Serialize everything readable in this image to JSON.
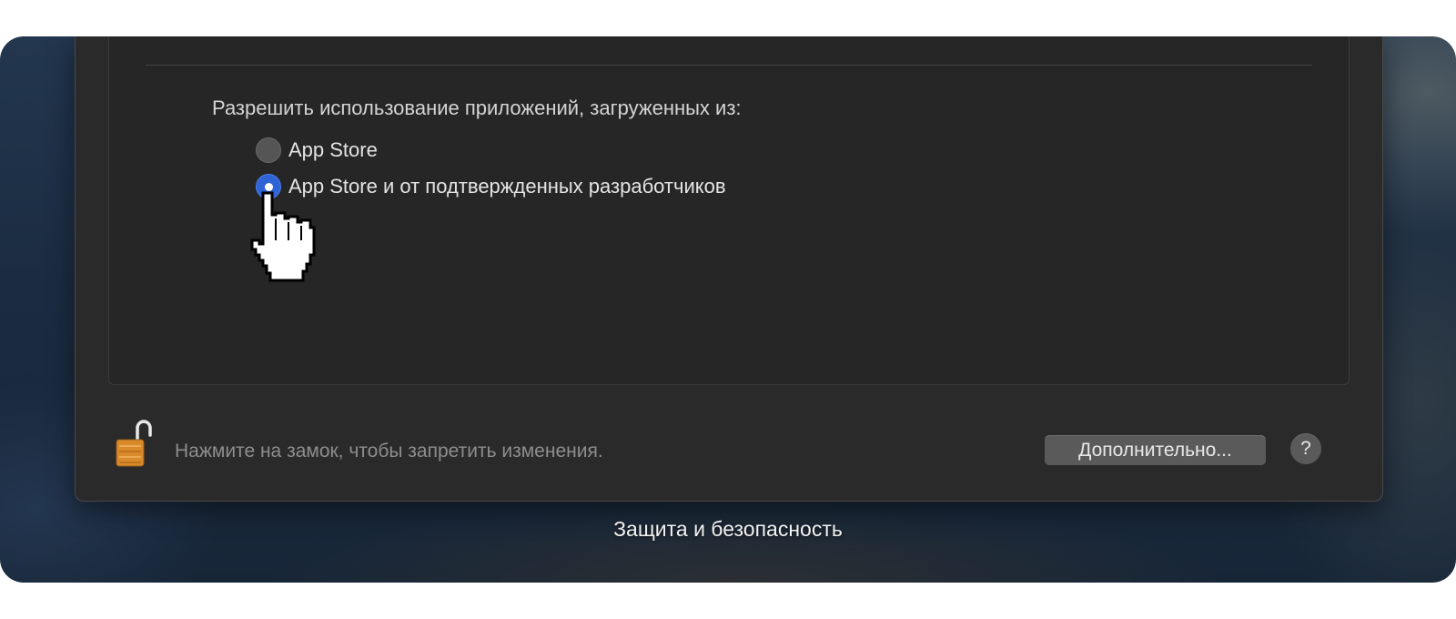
{
  "window": {
    "title": "Защита и безопасность"
  },
  "apps_section": {
    "label": "Разрешить использование приложений, загруженных из:",
    "options": [
      {
        "label": "App Store",
        "selected": false
      },
      {
        "label": "App Store и от подтвержденных разработчиков",
        "selected": true
      }
    ]
  },
  "footer": {
    "lock_icon": "unlocked-padlock-icon",
    "lock_hint": "Нажмите на замок, чтобы запретить изменения.",
    "advanced_label": "Дополнительно...",
    "help_label": "?"
  },
  "cursor": {
    "icon": "pointing-hand-cursor-icon"
  },
  "colors": {
    "accent": "#2f64d6",
    "window_bg": "#2a2a2a",
    "panel_bg": "#262626",
    "button_bg": "#5a5a5a"
  }
}
